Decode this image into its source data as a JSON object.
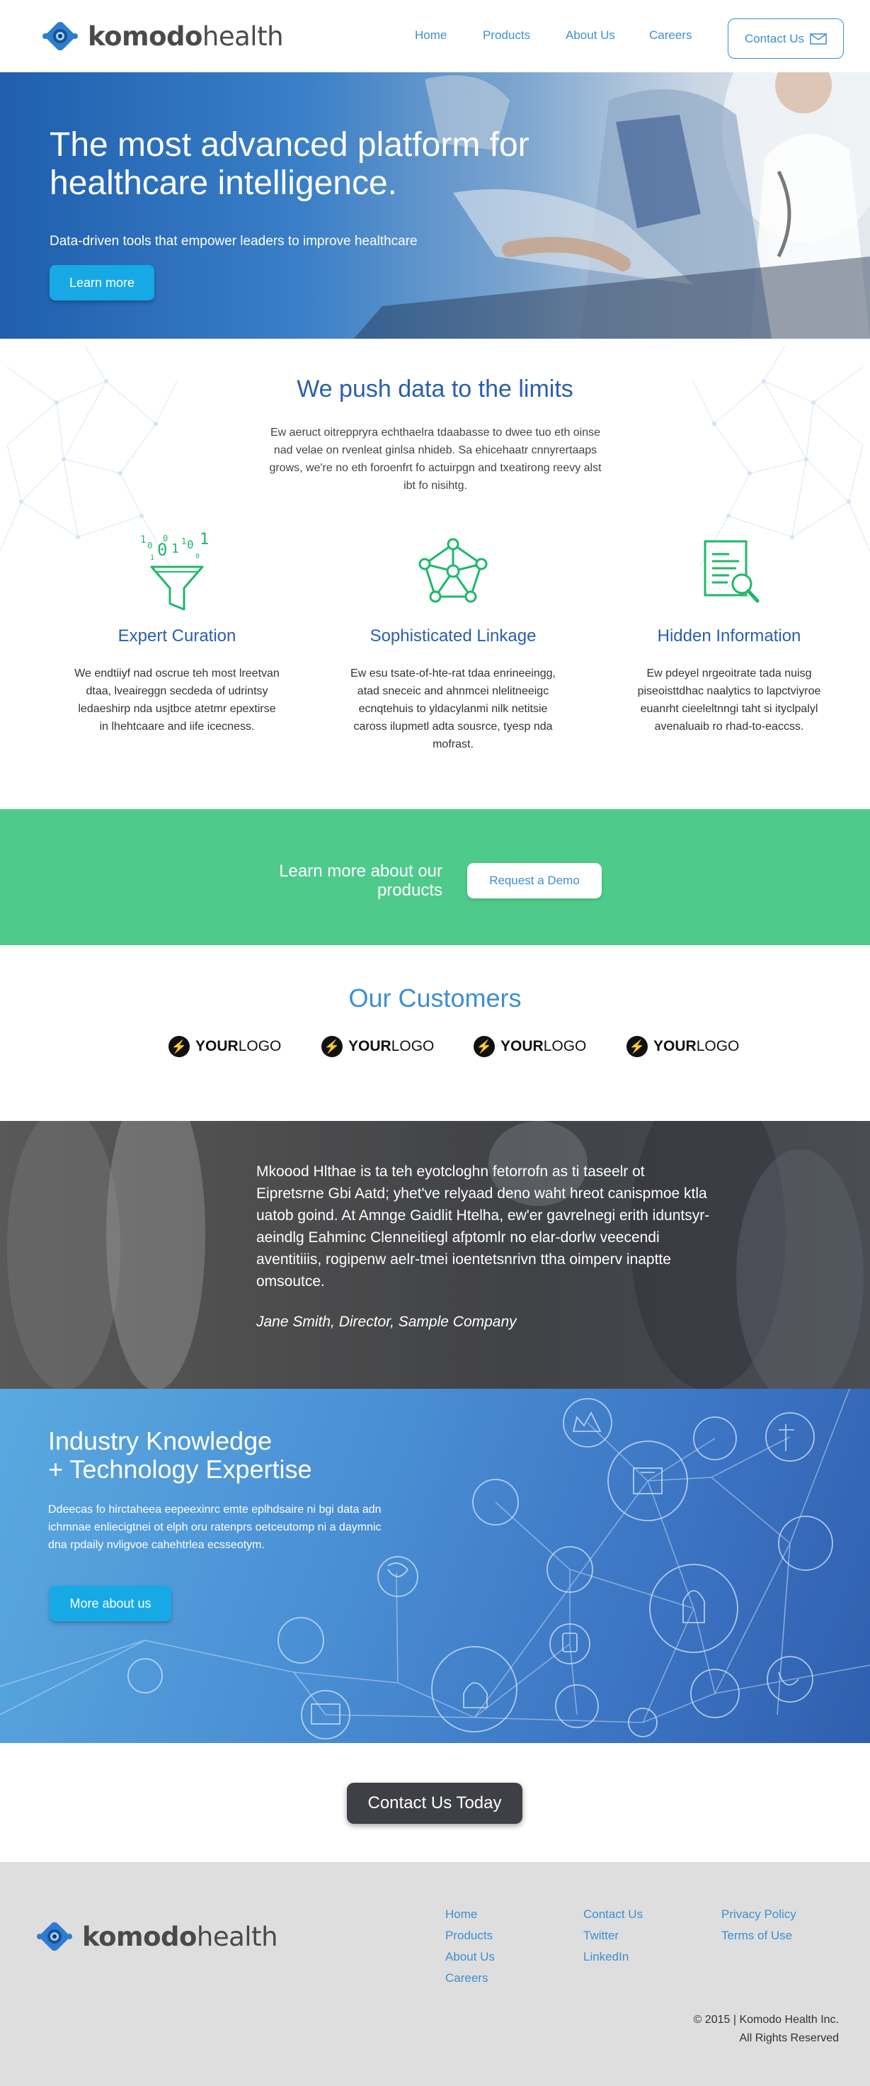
{
  "header": {
    "logo": {
      "bold": "komodo",
      "light": "health"
    },
    "nav": [
      "Home",
      "Products",
      "About Us",
      "Careers"
    ],
    "contact_label": "Contact Us"
  },
  "hero": {
    "title": "The most advanced platform for healthcare intelligence.",
    "subtitle": "Data-driven tools that empower leaders to improve healthcare",
    "button": "Learn more"
  },
  "push": {
    "title": "We push data to the limits",
    "paragraph": "Ew aeruct oitreppryra echthaelra tdaabasse to dwee tuo eth oinse nad velae on rvenleat ginlsa nhideb. Sa ehicehaatr cnnyrertaaps grows, we're no eth foroenfrt fo actuirpgn and txeatirong reevy alst ibt fo nisihtg.",
    "features": [
      {
        "icon": "funnel-icon",
        "title": "Expert Curation",
        "text": "We endtiiyf nad oscrue teh most lreetvan dtaa, lveaireggn secdeda of udrintsy ledaeshirp nda usjtbce atetmr epextirse in lhehtcaare and iife icecness."
      },
      {
        "icon": "network-icon",
        "title": "Sophisticated Linkage",
        "text": "Ew esu tsate-of-hte-rat tdaa enrineeingg, atad sneceic and ahnmcei nlelitneeigc ecnqtehuis to yldacylanmi nilk netitsie caross ilupmetl adta sousrce, tyesp nda mofrast."
      },
      {
        "icon": "document-search-icon",
        "title": "Hidden Information",
        "text": "Ew pdeyel nrgeoitrate tada nuisg piseoisttdhac naalytics to lapctviyroe euanrht cieeleltnngi taht si ityclpalyl avenaluaib ro rhad-to-eaccss."
      }
    ]
  },
  "cta": {
    "text": "Learn more about our products",
    "button": "Request a Demo"
  },
  "customers": {
    "title": "Our Customers",
    "logos": [
      {
        "bold": "YOUR",
        "light": "LOGO"
      },
      {
        "bold": "YOUR",
        "light": "LOGO"
      },
      {
        "bold": "YOUR",
        "light": "LOGO"
      },
      {
        "bold": "YOUR",
        "light": "LOGO"
      }
    ]
  },
  "testimonial": {
    "text": "Mkoood Hlthae is ta teh eyotcloghn fetorrofn as ti taseelr ot Eipretsrne Gbi Aatd; yhet've relyaad deno waht hreot canispmoe ktla uatob goind. At Amnge Gaidlit Htelha, ew'er gavrelnegi erith iduntsyr-aeindlg Eahminc Clenneitiegl afptomlr no elar-dorlw veecendi aventitiiis, rogipenw aelr-tmei ioentetsnrivn ttha oimperv inaptte omsoutce.",
    "author": "Jane Smith, Director, Sample Company"
  },
  "industry": {
    "title_line1": "Industry Knowledge",
    "title_line2": "+ Technology Expertise",
    "paragraph": "Ddeecas fo hirctaheea eepeexinrc emte eplhdsaire ni bgi data adn ichmnae enliecigtnei ot elph oru ratenprs oetceutomp ni a daymnic dna rpdaily nvligvoe cahehtrlea ecsseotym.",
    "button": "More about us"
  },
  "contact_today": "Contact Us Today",
  "footer": {
    "logo": {
      "bold": "komodo",
      "light": "health"
    },
    "col1": [
      "Home",
      "Products",
      "About Us",
      "Careers"
    ],
    "col2": [
      "Contact Us",
      "Twitter",
      "LinkedIn"
    ],
    "col3": [
      "Privacy Policy",
      "Terms of Use"
    ],
    "copyright_line1": "© 2015 | Komodo Health Inc.",
    "copyright_line2": "All Rights Reserved"
  },
  "colors": {
    "brand_blue": "#3d8fd1",
    "heading_blue": "#2a5fae",
    "cta_green": "#4ecb8a",
    "button_cyan": "#16a9e6",
    "icon_green": "#1fb86a",
    "dark_button": "#3f4045",
    "footer_gray": "#dedede"
  }
}
